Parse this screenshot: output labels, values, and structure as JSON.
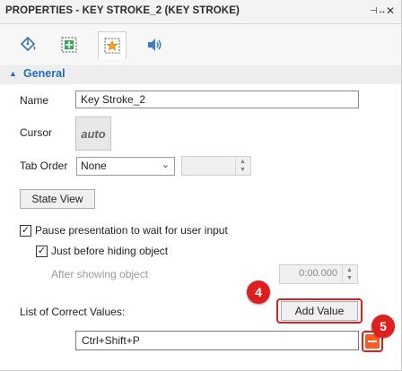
{
  "window": {
    "title": "PROPERTIES - KEY STROKE_2 (KEY STROKE)",
    "pin_glyph": "⊣↔",
    "close_glyph": "✕"
  },
  "tabs": [
    {
      "name": "fill-tab",
      "icon": "paint-bucket-icon"
    },
    {
      "name": "position-size-tab",
      "icon": "move-resize-icon"
    },
    {
      "name": "actions-tab",
      "icon": "star-action-icon",
      "active": true
    },
    {
      "name": "audio-tab",
      "icon": "speaker-icon"
    }
  ],
  "section": {
    "title": "General",
    "toggle_glyph": "▲"
  },
  "fields": {
    "name_label": "Name",
    "name_value": "Key Stroke_2",
    "cursor_label": "Cursor",
    "cursor_value": "auto",
    "tab_order_label": "Tab Order",
    "tab_order_value": "None",
    "chevron_glyph": "⌄",
    "up_glyph": "▲",
    "down_glyph": "▼"
  },
  "buttons": {
    "state_view": "State View",
    "add_value": "Add Value"
  },
  "options": {
    "pause_label": "Pause presentation to wait for user input",
    "pause_checked": true,
    "check_glyph": "✓",
    "before_hiding_label": "Just before hiding object",
    "before_hiding_checked": true,
    "after_showing_label": "After showing object",
    "after_showing_value": "0:00.000"
  },
  "correct_values": {
    "label": "List of Correct Values:",
    "items": [
      "Ctrl+Shift+P"
    ]
  },
  "callouts": {
    "add_value": "4",
    "remove_value": "5"
  },
  "colors": {
    "accent_blue": "#1e6fbf",
    "callout_red": "#dd1f1f",
    "remove_orange": "#ff5a1f"
  }
}
